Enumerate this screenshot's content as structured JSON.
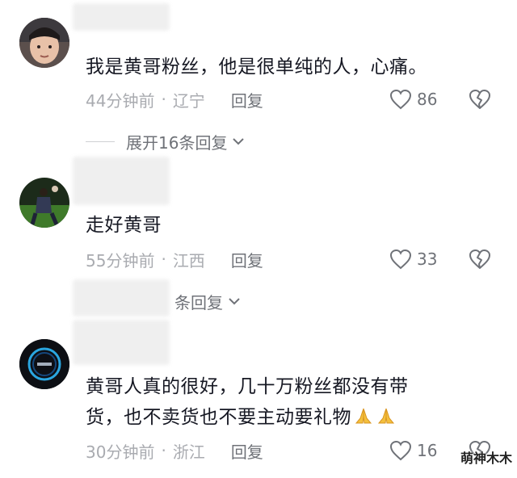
{
  "comments": [
    {
      "text": "我是黄哥粉丝，他是很单纯的人，心痛。",
      "time": "44分钟前",
      "location": "辽宁",
      "reply_label": "回复",
      "likes": "86",
      "expand_label": "展开16条回复"
    },
    {
      "text": "走好黄哥",
      "time": "55分钟前",
      "location": "江西",
      "reply_label": "回复",
      "likes": "33",
      "expand_label": "条回复"
    },
    {
      "text_line1": "黄哥人真的很好，几十万粉丝都没有带",
      "text_line2": "货，也不卖货也不要主动要礼物",
      "time": "30分钟前",
      "location": "浙江",
      "reply_label": "回复",
      "likes": "16"
    }
  ],
  "separator": "·",
  "watermark": "萌神木木",
  "colors": {
    "text": "#161823",
    "meta": "#a9abb0",
    "icon": "#6f7278"
  }
}
